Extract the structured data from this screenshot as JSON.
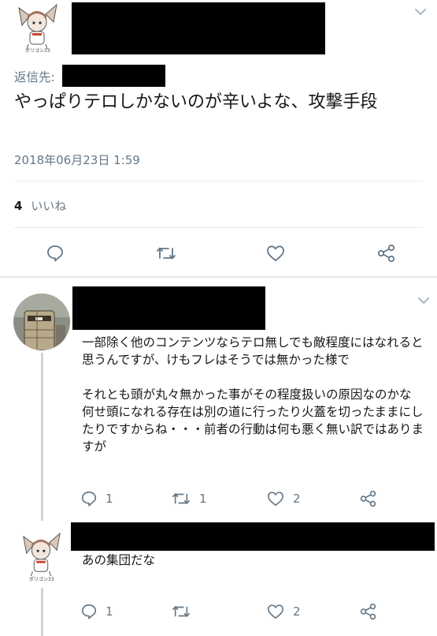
{
  "tweet": {
    "reply_to_label": "返信先:",
    "text": "やっぱりテロしかないのが辛いよな、攻撃手段",
    "timestamp": "2018年06月23日 1:59",
    "likes_count": "4",
    "likes_label": "いいね",
    "avatar_caption": "ポリゴン33"
  },
  "replies": [
    {
      "text": "一部除く他のコンテンツならテロ無しでも敵程度にはなれると思うんですが、けもフレはそうでは無かった様で\n\nそれとも頭が丸々無かった事がその程度扱いの原因なのかな\n何せ頭になれる存在は別の道に行ったり火蓋を切ったままにしたりですからね・・・前者の行動は何も悪く無い訳ではありますが",
      "reply_count": "1",
      "retweet_count": "1",
      "like_count": "2"
    },
    {
      "text": "あの集団だな",
      "reply_count": "1",
      "retweet_count": "",
      "like_count": "2",
      "avatar_caption": "ポリゴン33"
    }
  ],
  "colors": {
    "icon": "#657786",
    "divider": "#e6ecf0",
    "thread": "#ccd6dd"
  }
}
